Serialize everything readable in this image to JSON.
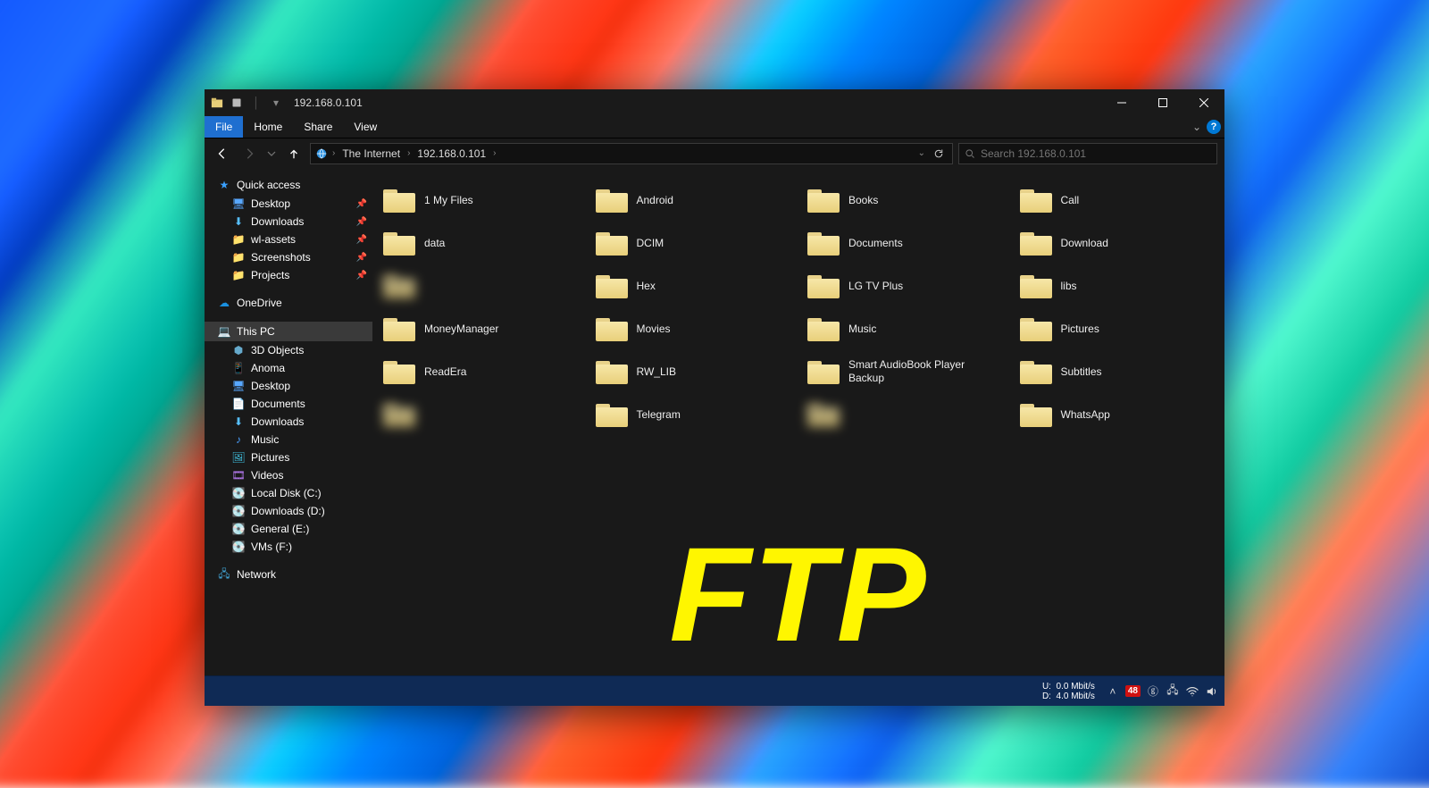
{
  "titlebar": {
    "title": "192.168.0.101"
  },
  "ribbon": {
    "file": "File",
    "tabs": [
      "Home",
      "Share",
      "View"
    ]
  },
  "address": {
    "segments": [
      "The Internet",
      "192.168.0.101"
    ],
    "search_placeholder": "Search 192.168.0.101"
  },
  "sidebar": {
    "quick_access": {
      "label": "Quick access",
      "items": [
        {
          "label": "Desktop",
          "pinned": true
        },
        {
          "label": "Downloads",
          "pinned": true
        },
        {
          "label": "wl-assets",
          "pinned": true
        },
        {
          "label": "Screenshots",
          "pinned": true
        },
        {
          "label": "Projects",
          "pinned": true
        }
      ]
    },
    "onedrive": {
      "label": "OneDrive"
    },
    "this_pc": {
      "label": "This PC",
      "items": [
        {
          "label": "3D Objects"
        },
        {
          "label": "Anoma"
        },
        {
          "label": "Desktop"
        },
        {
          "label": "Documents"
        },
        {
          "label": "Downloads"
        },
        {
          "label": "Music"
        },
        {
          "label": "Pictures"
        },
        {
          "label": "Videos"
        },
        {
          "label": "Local Disk (C:)"
        },
        {
          "label": "Downloads (D:)"
        },
        {
          "label": "General (E:)"
        },
        {
          "label": "VMs (F:)"
        }
      ]
    },
    "network": {
      "label": "Network"
    }
  },
  "folders": [
    {
      "label": "1 My Files"
    },
    {
      "label": "Android"
    },
    {
      "label": "Books"
    },
    {
      "label": "Call"
    },
    {
      "label": "data"
    },
    {
      "label": "DCIM"
    },
    {
      "label": "Documents"
    },
    {
      "label": "Download"
    },
    {
      "label": "",
      "blur": true
    },
    {
      "label": "Hex"
    },
    {
      "label": "LG TV Plus"
    },
    {
      "label": "libs"
    },
    {
      "label": "MoneyManager"
    },
    {
      "label": "Movies"
    },
    {
      "label": "Music"
    },
    {
      "label": "Pictures"
    },
    {
      "label": "ReadEra"
    },
    {
      "label": "RW_LIB"
    },
    {
      "label": "Smart AudioBook Player Backup"
    },
    {
      "label": "Subtitles"
    },
    {
      "label": "",
      "blur": true
    },
    {
      "label": "Telegram"
    },
    {
      "label": "",
      "blur": true
    },
    {
      "label": "WhatsApp"
    }
  ],
  "overlay": "FTP",
  "taskbar": {
    "net": {
      "up_label": "U:",
      "up": "0.0 Mbit/s",
      "down_label": "D:",
      "down": "4.0 Mbit/s"
    },
    "temp_badge": "48"
  }
}
